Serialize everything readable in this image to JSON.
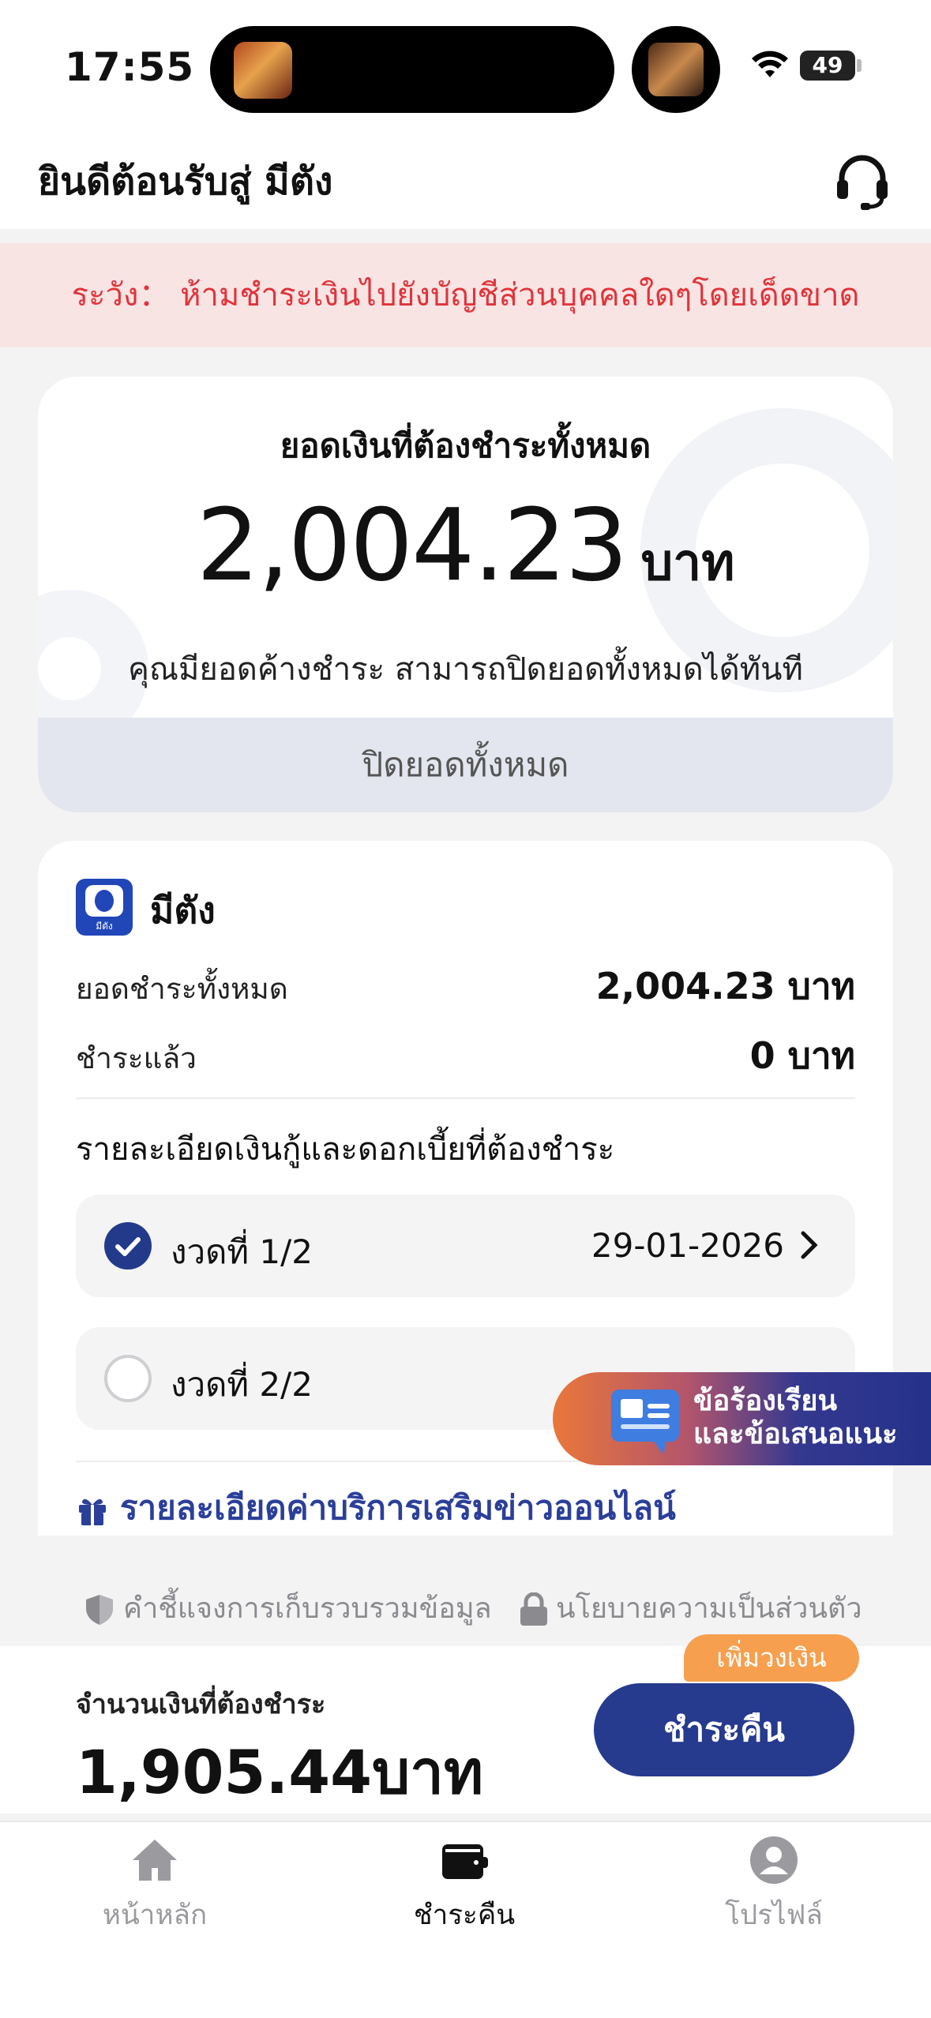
{
  "status_bar": {
    "time": "17:55",
    "battery": "49"
  },
  "header": {
    "title": "ยินดีต้อนรับสู่ มีตัง"
  },
  "warning": {
    "text": "ระวัง：  ห้ามชำระเงินไปยังบัญชีส่วนบุคคลใดๆโดยเด็ดขาด"
  },
  "total_card": {
    "label": "ยอดเงินที่ต้องชำระทั้งหมด",
    "amount": "2,004.23",
    "unit": "บาท",
    "note": "คุณมียอดค้างชำระ  สามารถปิดยอดทั้งหมดได้ทันที",
    "close_all_label": "ปิดยอดทั้งหมด"
  },
  "loan_card": {
    "brand_name": "มีตัง",
    "logo_text": "มีตัง",
    "total_due_label": "ยอดชำระทั้งหมด",
    "total_due_value": "2,004.23 บาท",
    "paid_label": "ชำระแล้ว",
    "paid_value": "0 บาท",
    "section_title": "รายละเอียดเงินกู้และดอกเบี้ยที่ต้องชำระ",
    "installments": [
      {
        "label": "งวดที่ 1/2",
        "date": "29-01-2026",
        "selected": true
      },
      {
        "label": "งวดที่ 2/2",
        "date": "",
        "selected": false
      }
    ],
    "addon_label": "รายละเอียดค่าบริการเสริมข่าวออนไลน์"
  },
  "feedback": {
    "line1": "ข้อร้องเรียน",
    "line2": "และข้อเสนอแนะ"
  },
  "footer_links": {
    "data_collection": "คำชี้แจงการเก็บรวบรวมข้อมูล",
    "privacy": "นโยบายความเป็นส่วนตัว"
  },
  "pay_bar": {
    "label": "จำนวนเงินที่ต้องชำระ",
    "amount": "1,905.44บาท",
    "button": "ชำระคืน",
    "badge": "เพิ่มวงเงิน"
  },
  "nav": {
    "items": [
      {
        "label": "หน้าหลัก",
        "icon": "home-icon"
      },
      {
        "label": "ชำระคืน",
        "icon": "wallet-icon"
      },
      {
        "label": "โปรไฟล์",
        "icon": "profile-icon"
      }
    ]
  },
  "colors": {
    "primary": "#263a8e",
    "warning": "#e0343a",
    "badge": "#f6a04f"
  }
}
